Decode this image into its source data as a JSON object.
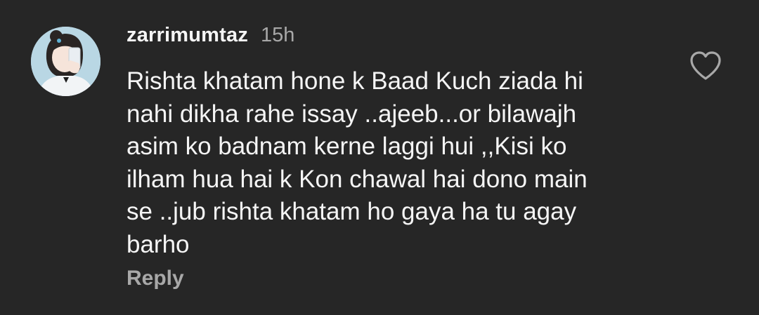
{
  "comment": {
    "username": "zarrimumtaz",
    "timestamp": "15h",
    "text": "Rishta khatam hone k Baad Kuch ziada hi\nnahi dikha rahe issay ..ajeeb...or bilawajh\nasim ko badnam kerne laggi hui ,,Kisi ko\nilham hua hai k Kon chawal hai dono main\nse ..jub rishta khatam ho gaya ha tu agay\nbarho",
    "reply_label": "Reply",
    "avatar_icon": "avatar-illustration",
    "like_icon": "heart-outline-icon"
  },
  "colors": {
    "background": "#262626",
    "primary_text": "#f5f5f5",
    "secondary_text": "#a8a8a8"
  }
}
